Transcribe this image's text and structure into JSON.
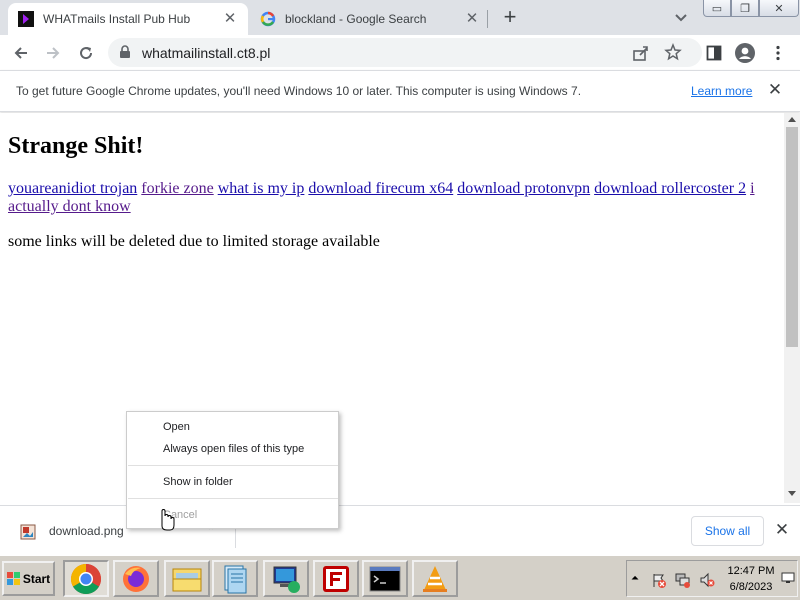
{
  "tabs": [
    {
      "title": "WHATmails Install Pub Hub",
      "active": true
    },
    {
      "title": "blockland - Google Search",
      "active": false
    }
  ],
  "window_controls": {
    "minimize": "▭",
    "restore": "❐",
    "close": "✕"
  },
  "omnibox": {
    "url": "whatmailinstall.ct8.pl"
  },
  "infobar": {
    "message": "To get future Google Chrome updates, you'll need Windows 10 or later. This computer is using Windows 7.",
    "link": "Learn more"
  },
  "page": {
    "heading": "Strange Shit!",
    "links": [
      "youareanidiot trojan",
      "forkie zone",
      "what is my ip",
      "download firecum x64",
      "download protonvpn",
      "download rollercoster 2",
      "i actually dont know"
    ],
    "note": "some links will be deleted due to limited storage available"
  },
  "context_menu": {
    "items": [
      "Open",
      "Always open files of this type",
      "Show in folder",
      "Cancel"
    ]
  },
  "downloads": {
    "file_name": "download.png",
    "show_all": "Show all"
  },
  "taskbar": {
    "start_label": "Start",
    "apps": [
      "chrome-icon",
      "firefox-icon",
      "folder-icon",
      "document-icon",
      "network-icon",
      "filezilla-icon",
      "cmd-icon",
      "vlc-icon"
    ],
    "time": "12:47 PM",
    "date": "6/8/2023"
  },
  "colors": {
    "accent": "#1a73e8",
    "link": "#1a0dab",
    "visited_link": "#551a8b",
    "taskbar": "#d4d0c8"
  }
}
